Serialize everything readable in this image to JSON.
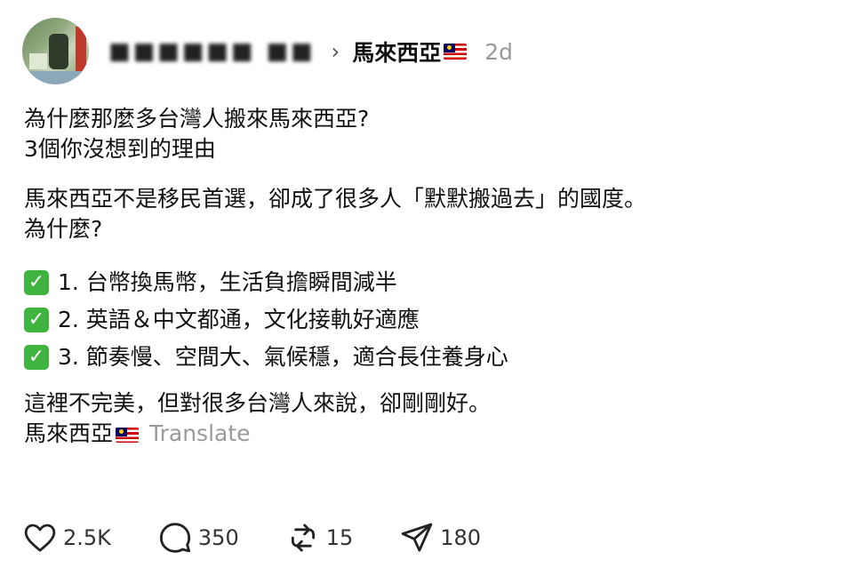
{
  "post": {
    "username": "■■■■■■ ■■",
    "chevron": "›",
    "topic": "馬來西亞",
    "time": "2d",
    "lines": {
      "l1": "為什麼那麼多台灣人搬來馬來西亞?",
      "l2": "3個你沒想到的理由",
      "l3": "馬來西亞不是移民首選，卻成了很多人「默默搬過去」的國度。",
      "l4": "為什麼?",
      "r1": "1. 台幣換馬幣，生活負擔瞬間減半",
      "r2": "2. 英語＆中文都通，文化接軌好適應",
      "r3": "3. 節奏慢、空間大、氣候穩，適合長住養身心",
      "l5": "這裡不完美，但對很多台灣人來說，卻剛剛好。",
      "tag": "馬來西亞"
    },
    "translate": "Translate"
  },
  "actions": {
    "likes": "2.5K",
    "comments": "350",
    "reposts": "15",
    "shares": "180"
  },
  "icons": {
    "like": "heart-icon",
    "comment": "comment-bubble-icon",
    "repost": "repost-icon",
    "share": "send-icon",
    "check": "green-check-icon",
    "flag": "malaysia-flag-icon"
  },
  "colors": {
    "check_bg": "#3fb43f",
    "muted": "#999999"
  }
}
